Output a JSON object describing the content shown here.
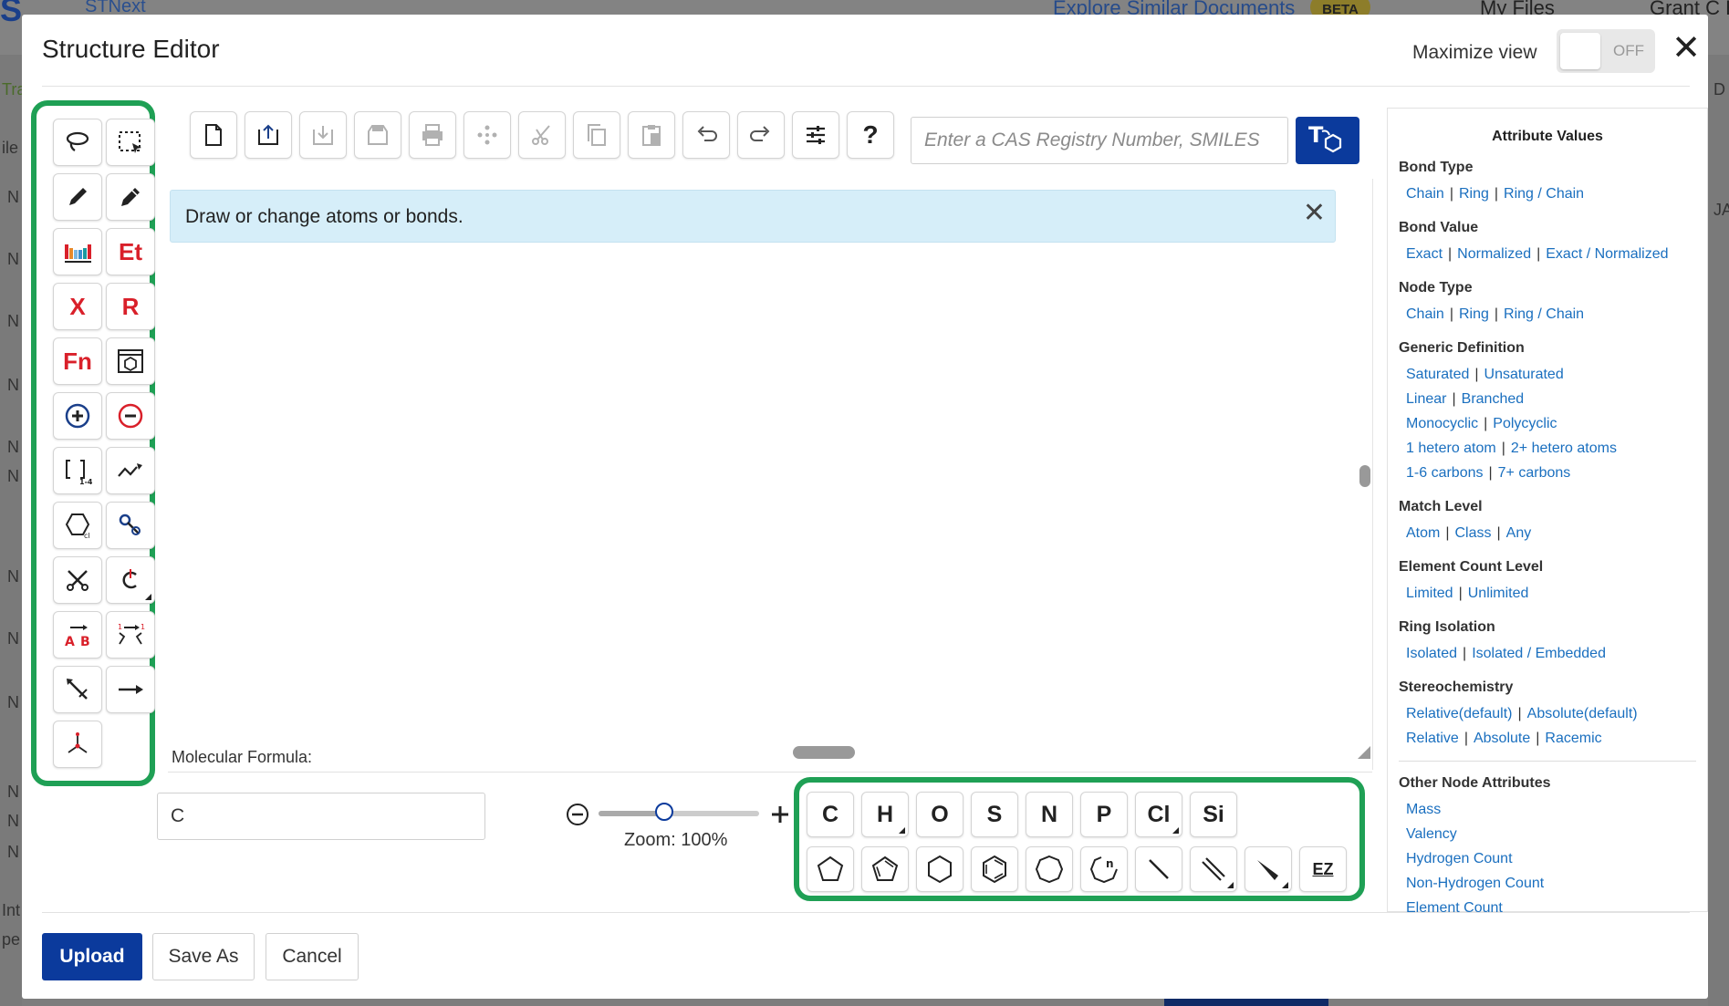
{
  "background": {
    "logo": "S",
    "app_name": "STNext",
    "explore_link": "Explore Similar Documents",
    "beta_badge": "BETA",
    "my_files": "My Files",
    "user": "Grant C E",
    "left_letters": [
      "Tra",
      "ile",
      "N",
      "N",
      "N",
      "N",
      "N",
      "N",
      "N",
      "N",
      "N",
      "N",
      "N",
      "N",
      "Int",
      "pe"
    ],
    "right_letters": [
      "D",
      "JA"
    ]
  },
  "modal": {
    "title": "Structure Editor",
    "maximize_label": "Maximize view",
    "toggle_state": "OFF"
  },
  "left_palette": {
    "tools": [
      {
        "name": "lasso-select",
        "label": ""
      },
      {
        "name": "rect-select",
        "label": ""
      },
      {
        "name": "pencil-draw",
        "label": ""
      },
      {
        "name": "pencil-edit",
        "label": ""
      },
      {
        "name": "periodic-table",
        "label": ""
      },
      {
        "name": "ethyl-shortcut",
        "label": "Et"
      },
      {
        "name": "variable-x",
        "label": "X"
      },
      {
        "name": "rgroup",
        "label": "R"
      },
      {
        "name": "function-group",
        "label": "Fn"
      },
      {
        "name": "template",
        "label": ""
      },
      {
        "name": "charge-plus",
        "label": ""
      },
      {
        "name": "charge-minus",
        "label": ""
      },
      {
        "name": "repeat-bracket",
        "label": "1-4"
      },
      {
        "name": "chain",
        "label": ""
      },
      {
        "name": "ring-count",
        "label": ""
      },
      {
        "name": "bond-lock",
        "label": ""
      },
      {
        "name": "bond-cut",
        "label": ""
      },
      {
        "name": "stereo-center",
        "label": ""
      },
      {
        "name": "reaction-ab",
        "label": "A B"
      },
      {
        "name": "atom-mapping",
        "label": "1 1"
      },
      {
        "name": "measure",
        "label": ""
      },
      {
        "name": "reaction-arrow",
        "label": ""
      },
      {
        "name": "attachment-point",
        "label": ""
      }
    ]
  },
  "toolbar": {
    "search_placeholder": "Enter a CAS Registry Number, SMILES",
    "help_label": "?"
  },
  "canvas": {
    "info_banner": "Draw or change atoms or bonds.",
    "molecular_formula_label": "Molecular Formula:",
    "molecular_formula_value": "C"
  },
  "zoom": {
    "label": "Zoom: 100%",
    "value_fraction": 0.41
  },
  "bottom_palette": {
    "atoms": [
      {
        "label": "C",
        "has_menu": false
      },
      {
        "label": "H",
        "has_menu": true
      },
      {
        "label": "O",
        "has_menu": false
      },
      {
        "label": "S",
        "has_menu": false
      },
      {
        "label": "N",
        "has_menu": false
      },
      {
        "label": "P",
        "has_menu": false
      },
      {
        "label": "Cl",
        "has_menu": true
      },
      {
        "label": "Si",
        "has_menu": false
      }
    ],
    "shapes": [
      "cyclopentane",
      "cyclopentadiene",
      "cyclohexane",
      "benzene",
      "cycloheptane",
      "custom-ring",
      "single-bond",
      "multi-bond",
      "wedge-bond",
      "ez-stereo"
    ],
    "ez_label": "EZ"
  },
  "attributes": {
    "title": "Attribute Values",
    "sections": [
      {
        "heading": "Bond Type",
        "rows": [
          [
            "Chain",
            "Ring",
            "Ring / Chain"
          ]
        ]
      },
      {
        "heading": "Bond Value",
        "rows": [
          [
            "Exact",
            "Normalized",
            "Exact / Normalized"
          ]
        ]
      },
      {
        "heading": "Node Type",
        "rows": [
          [
            "Chain",
            "Ring",
            "Ring / Chain"
          ]
        ]
      },
      {
        "heading": "Generic Definition",
        "rows": [
          [
            "Saturated",
            "Unsaturated"
          ],
          [
            "Linear",
            "Branched"
          ],
          [
            "Monocyclic",
            "Polycyclic"
          ],
          [
            "1 hetero atom",
            "2+ hetero atoms"
          ],
          [
            "1-6 carbons",
            "7+ carbons"
          ]
        ]
      },
      {
        "heading": "Match Level",
        "rows": [
          [
            "Atom",
            "Class",
            "Any"
          ]
        ]
      },
      {
        "heading": "Element Count Level",
        "rows": [
          [
            "Limited",
            "Unlimited"
          ]
        ]
      },
      {
        "heading": "Ring Isolation",
        "rows": [
          [
            "Isolated",
            "Isolated / Embedded"
          ]
        ]
      },
      {
        "heading": "Stereochemistry",
        "rows": [
          [
            "Relative(default)",
            "Absolute(default)"
          ],
          [
            "Relative",
            "Absolute",
            "Racemic"
          ]
        ]
      }
    ],
    "other_heading": "Other Node Attributes",
    "other_links": [
      "Mass",
      "Valency",
      "Hydrogen Count",
      "Non-Hydrogen Count",
      "Element Count"
    ]
  },
  "footer": {
    "upload": "Upload",
    "save_as": "Save As",
    "cancel": "Cancel"
  },
  "colors": {
    "primary": "#0b3a9c",
    "highlight_green": "#1fa055",
    "link": "#1a6fbf",
    "red_label": "#d9202a",
    "info_bg": "#d6eef9"
  }
}
